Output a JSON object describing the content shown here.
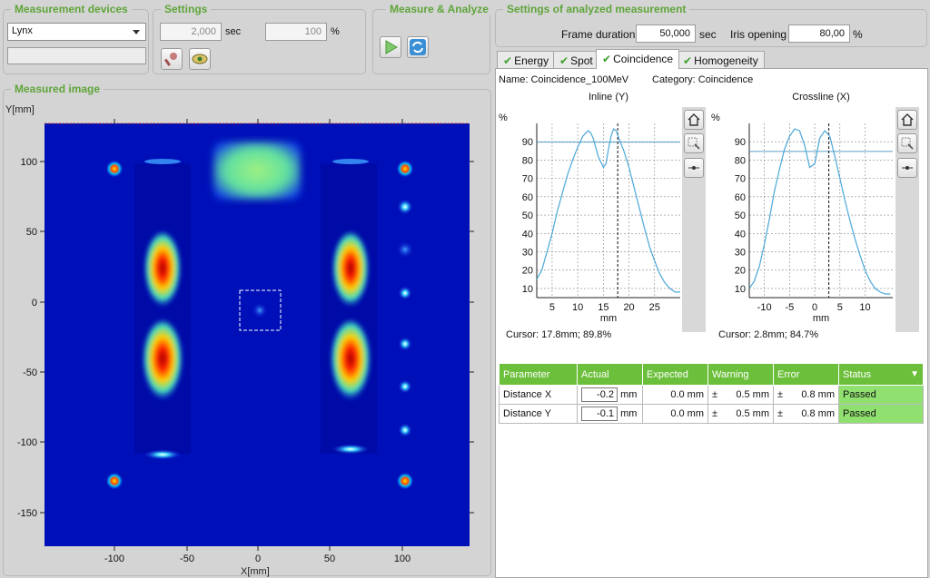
{
  "devices": {
    "title": "Measurement devices",
    "device": "Lynx",
    "info": ""
  },
  "settings": {
    "title": "Settings",
    "exposure_value": "2,000",
    "exposure_unit": "sec",
    "percent_value": "100",
    "percent_unit": "%"
  },
  "measure": {
    "title": "Measure & Analyze"
  },
  "analyzed": {
    "title": "Settings of analyzed measurement",
    "frame_label": "Frame duration",
    "frame_value": "50,000",
    "frame_unit": "sec",
    "iris_label": "Iris opening",
    "iris_value": "80,00",
    "iris_unit": "%"
  },
  "image_panel": {
    "title": "Measured image",
    "y_axis_label": "Y[mm]",
    "x_axis_label": "X[mm]",
    "y_ticks": [
      "100",
      "50",
      "0",
      "-50",
      "-100",
      "-150"
    ],
    "x_ticks": [
      "-100",
      "-50",
      "0",
      "50",
      "100"
    ]
  },
  "tabs": [
    "Energy",
    "Spot",
    "Coincidence",
    "Homogeneity"
  ],
  "info": {
    "name": "Name: Coincidence_100MeV",
    "category": "Category: Coincidence"
  },
  "colors": {
    "accent": "#5fa53a",
    "curve": "#4aa7d8",
    "status_pass": "#90e070",
    "header": "#6cbf3a"
  },
  "icons": [
    "home-icon",
    "zoom-icon",
    "cursor-icon",
    "play-icon",
    "refresh-icon",
    "tool-icon",
    "image-icon"
  ],
  "chart_data": [
    {
      "type": "line",
      "title": "Inline (Y)",
      "xlabel": "mm",
      "ylabel": "%",
      "x_ticks": [
        "5",
        "10",
        "15",
        "20",
        "25"
      ],
      "y_ticks": [
        "10",
        "20",
        "30",
        "40",
        "50",
        "60",
        "70",
        "80",
        "90"
      ],
      "xlim": [
        2,
        30
      ],
      "ylim": [
        5,
        100
      ],
      "x": [
        2,
        3,
        4,
        5,
        6,
        7,
        8,
        9,
        10,
        11,
        12,
        12.5,
        13,
        14,
        15,
        15.5,
        16,
        16.5,
        17,
        17.5,
        18,
        19,
        20,
        21,
        22,
        23,
        24,
        25,
        26,
        27,
        28,
        29,
        30
      ],
      "y": [
        15,
        20,
        30,
        40,
        52,
        62,
        72,
        80,
        87,
        93,
        96,
        95,
        92,
        82,
        76,
        78,
        86,
        93,
        97,
        96,
        92,
        85,
        76,
        65,
        54,
        43,
        33,
        25,
        18,
        13,
        10,
        8,
        8
      ],
      "hline": 89.8,
      "cursor_x": 17.8,
      "cursor_text": "Cursor: 17.8mm; 89.8%"
    },
    {
      "type": "line",
      "title": "Crossline (X)",
      "xlabel": "mm",
      "ylabel": "%",
      "x_ticks": [
        "-10",
        "-5",
        "0",
        "5",
        "10"
      ],
      "y_ticks": [
        "10",
        "20",
        "30",
        "40",
        "50",
        "60",
        "70",
        "80",
        "90"
      ],
      "xlim": [
        -13,
        15.5
      ],
      "ylim": [
        5,
        100
      ],
      "x": [
        -13,
        -12,
        -11,
        -10,
        -9,
        -8,
        -7,
        -6,
        -5,
        -4,
        -3,
        -2,
        -1,
        0,
        1,
        2,
        3,
        4,
        5,
        6,
        7,
        8,
        9,
        10,
        11,
        12,
        13,
        14,
        15
      ],
      "y": [
        10,
        14,
        22,
        34,
        48,
        63,
        75,
        86,
        93,
        97,
        96,
        88,
        76,
        78,
        92,
        96,
        93,
        82,
        70,
        58,
        47,
        37,
        28,
        20,
        14,
        10,
        8,
        7,
        7
      ],
      "hline": 84.7,
      "cursor_x": 2.8,
      "cursor_text": "Cursor: 2.8mm; 84.7%"
    }
  ],
  "table": {
    "headers": [
      "Parameter",
      "Actual",
      "Expected",
      "Warning",
      "Error",
      "Status"
    ],
    "rows": [
      {
        "param": "Distance X",
        "actual": "-0.2",
        "unit": "mm",
        "expected": "0.0 mm",
        "warn_pm": "±",
        "warning": "0.5 mm",
        "err_pm": "±",
        "error": "0.8 mm",
        "status": "Passed"
      },
      {
        "param": "Distance Y",
        "actual": "-0.1",
        "unit": "mm",
        "expected": "0.0 mm",
        "warn_pm": "±",
        "warning": "0.5 mm",
        "err_pm": "±",
        "error": "0.8 mm",
        "status": "Passed"
      }
    ]
  }
}
